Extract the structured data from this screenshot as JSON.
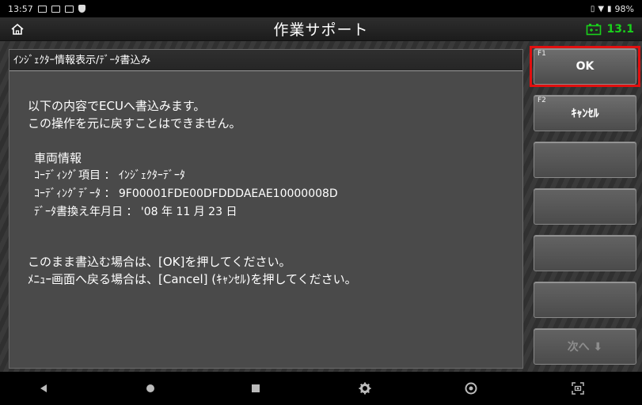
{
  "status_bar": {
    "time": "13:57",
    "battery_text": "98%",
    "icons": [
      "mail-icon",
      "gallery-icon",
      "gallery-icon",
      "shield-icon",
      "vibrate-icon",
      "wifi-icon",
      "battery-icon"
    ]
  },
  "title_bar": {
    "title": "作業サポート",
    "voltage": "13.1",
    "voltage_color": "#19d11b",
    "home_icon": "home-icon",
    "battery_icon": "car-battery-icon"
  },
  "panel": {
    "header": "ｲﾝｼﾞｪｸﾀｰ情報表示/ﾃﾞｰﾀ書込み",
    "message_line1": "以下の内容でECUへ書込みます。",
    "message_line2": "この操作を元に戻すことはできません。",
    "vehicle_info_title": "車両情報",
    "coding_item_label": "ｺｰﾃﾞｨﾝｸﾞ項目 ： ｲﾝｼﾞｪｸﾀｰﾃﾞｰﾀ",
    "coding_data_label": "ｺｰﾃﾞｨﾝｸﾞﾃﾞｰﾀ ： 9F00001FDE00DFDDDAEAE10000008D",
    "rewrite_date_label": "ﾃﾞｰﾀ書換え年月日 ： '08 年 11 月 23 日",
    "instruction_ok": "このまま書込む場合は、[OK]を押してください。",
    "instruction_cancel": "ﾒﾆｭｰ画面へ戻る場合は、[Cancel] (ｷｬﾝｾﾙ)を押してください。"
  },
  "function_keys": [
    {
      "number": "F1",
      "label": "OK",
      "highlighted": true,
      "enabled": true
    },
    {
      "number": "F2",
      "label": "ｷｬﾝｾﾙ",
      "highlighted": false,
      "enabled": true
    },
    {
      "number": "",
      "label": "",
      "enabled": false
    },
    {
      "number": "",
      "label": "",
      "enabled": false
    },
    {
      "number": "",
      "label": "",
      "enabled": false
    },
    {
      "number": "",
      "label": "",
      "enabled": false
    },
    {
      "number": "",
      "label": "次へ ⬇",
      "enabled": false
    }
  ],
  "nav_bar": {
    "icons": [
      "back-icon",
      "home-nav-icon",
      "recents-icon",
      "settings-icon",
      "browser-icon",
      "screenshot-icon"
    ]
  },
  "colors": {
    "highlight": "#e10f0f",
    "panel_bg": "#4a4a4a"
  }
}
